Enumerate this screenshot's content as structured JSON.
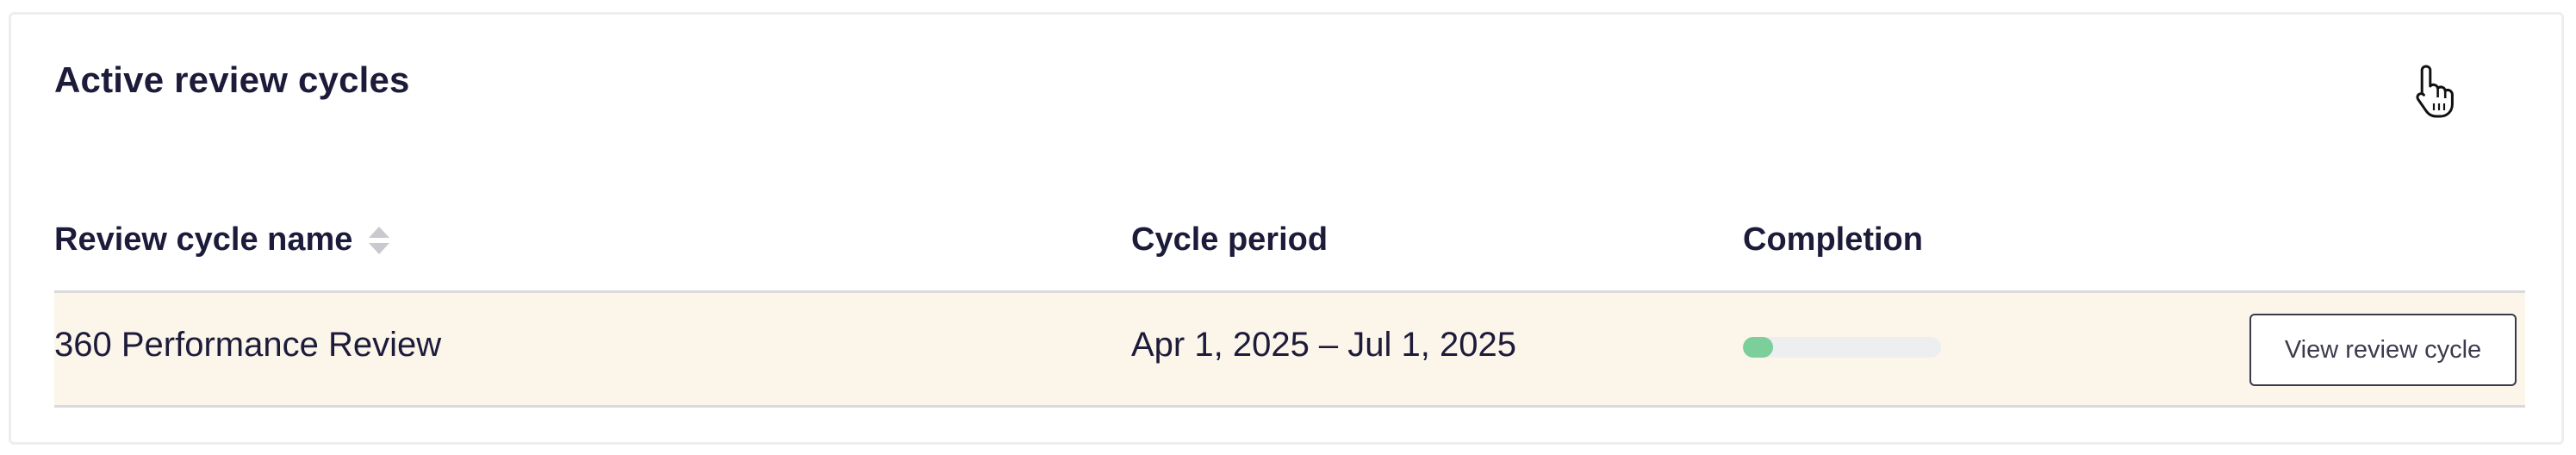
{
  "section": {
    "title": "Active review cycles"
  },
  "table": {
    "columns": {
      "name": "Review cycle name",
      "period": "Cycle period",
      "completion": "Completion"
    },
    "rows": [
      {
        "name": "360 Performance Review",
        "period": "Apr 1, 2025 – Jul 1, 2025",
        "completion_fraction": 0.15,
        "action_label": "View review cycle"
      }
    ]
  },
  "colors": {
    "row_highlight": "#fbf5ea",
    "progress_fill": "#7ccf9a",
    "progress_track": "#eceef0",
    "text": "#1d1b3a"
  },
  "icons": {
    "sort": "sort-icon",
    "cursor": "hand-pointer-icon"
  }
}
